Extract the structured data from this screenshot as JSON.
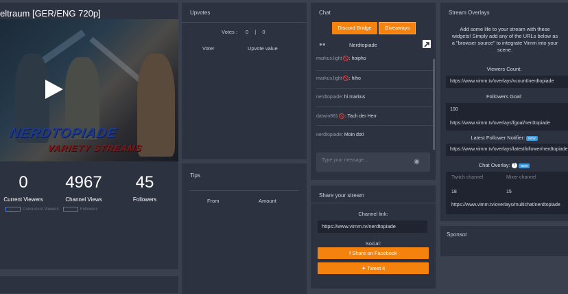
{
  "video": {
    "title": "eltraum [GER/ENG 720p]",
    "watermark_line1": "NERDTOPIADE",
    "watermark_line2": "VARIETY STREAMS"
  },
  "stats": [
    {
      "value": "0",
      "label": "Current Viewers"
    },
    {
      "value": "4967",
      "label": "Channel Views"
    },
    {
      "value": "45",
      "label": "Followers"
    }
  ],
  "legend": {
    "current_viewers": "Concurrent Viewers",
    "followers": "Followers"
  },
  "upvotes": {
    "title": "Upvotes",
    "votes_label": "Votes :",
    "votes_a": "0",
    "votes_sep": "|",
    "votes_b": "0",
    "col_voter": "Voter",
    "col_value": "Upvote value"
  },
  "tips": {
    "title": "Tips",
    "col_from": "From",
    "col_amount": "Amount"
  },
  "chat": {
    "title": "Chat",
    "discord_button": "Discord Bridge",
    "giveaways_button": "Giveaways",
    "channel": "Nerdtopiade",
    "messages": [
      {
        "user": "markus.light",
        "text": ": hoipho"
      },
      {
        "user": "markus.light",
        "text": ": hiho"
      },
      {
        "user": "nerdtopiade",
        "text": ": hi markus"
      },
      {
        "user": "datwin881",
        "text": ": Tach der Herr"
      },
      {
        "user": "nerdtopiade",
        "text": ": Moin doti"
      }
    ],
    "input_placeholder": "Type your message..."
  },
  "share": {
    "title": "Share your stream",
    "channel_link_label": "Channel link:",
    "channel_link": "https://www.vimm.tv/nerdtopiade",
    "social_label": "Social:",
    "facebook_button": "Share on Facebook",
    "twitter_button": "Tweet it"
  },
  "overlays": {
    "title": "Stream Overlays",
    "description": "Add some life to your stream with these widgets! Simply add any of the URLs below as a \"browser source\" to integrate Vimm into your scene.",
    "viewers_count_label": "Viewers Count:",
    "viewers_count_url": "https://www.vimm.tv/overlays/vcount/nerdtopiade",
    "followers_goal_label": "Followers Goal:",
    "followers_goal_value": "100",
    "followers_goal_url": "https://www.vimm.tv/overlays/fgoal/nerdtopiade",
    "latest_follower_label": "Latest Follower Notifier:",
    "new_badge": "NEW",
    "latest_follower_url": "https://www.vimm.tv/overlays/latestfollower/nerdtopiade",
    "chat_overlay_label": "Chat Overlay:",
    "twitch_channel_placeholder": "Twitch channel",
    "mixer_channel_placeholder": "Mixer channel",
    "twitch_channel_value": "18",
    "mixer_channel_value": "15",
    "chat_overlay_url": "https://www.vimm.tv/overlays/multichat/nerdtopiade"
  },
  "sponsor": {
    "title": "Sponsor"
  },
  "colors": {
    "accent": "#f5820d",
    "panel": "#2c3240",
    "background": "#3a404d",
    "badge": "#3b9ae1"
  }
}
